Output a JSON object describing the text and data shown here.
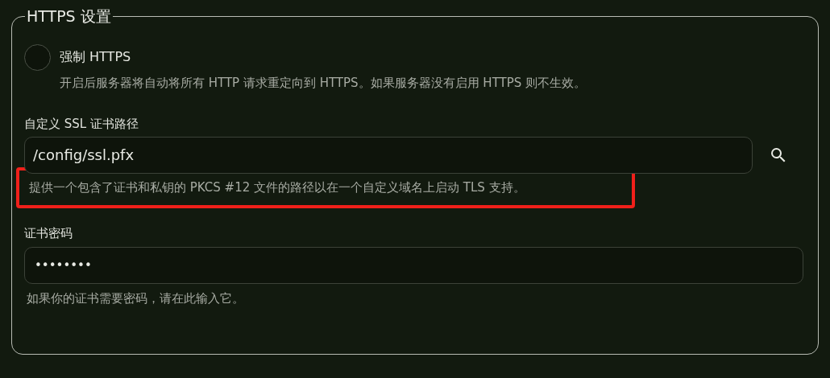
{
  "section": {
    "title": "HTTPS 设置"
  },
  "force_https": {
    "label": "强制 HTTPS",
    "checked": false,
    "description": "开启后服务器将自动将所有 HTTP 请求重定向到 HTTPS。如果服务器没有启用 HTTPS 则不生效。"
  },
  "ssl_path": {
    "label": "自定义 SSL 证书路径",
    "value": "/config/ssl.pfx",
    "hint": "提供一个包含了证书和私钥的 PKCS #12 文件的路径以在一个自定义域名上启动 TLS 支持。",
    "highlighted": true
  },
  "password": {
    "label": "证书密码",
    "value": "••••••••",
    "hint": "如果你的证书需要密码，请在此输入它。"
  }
}
